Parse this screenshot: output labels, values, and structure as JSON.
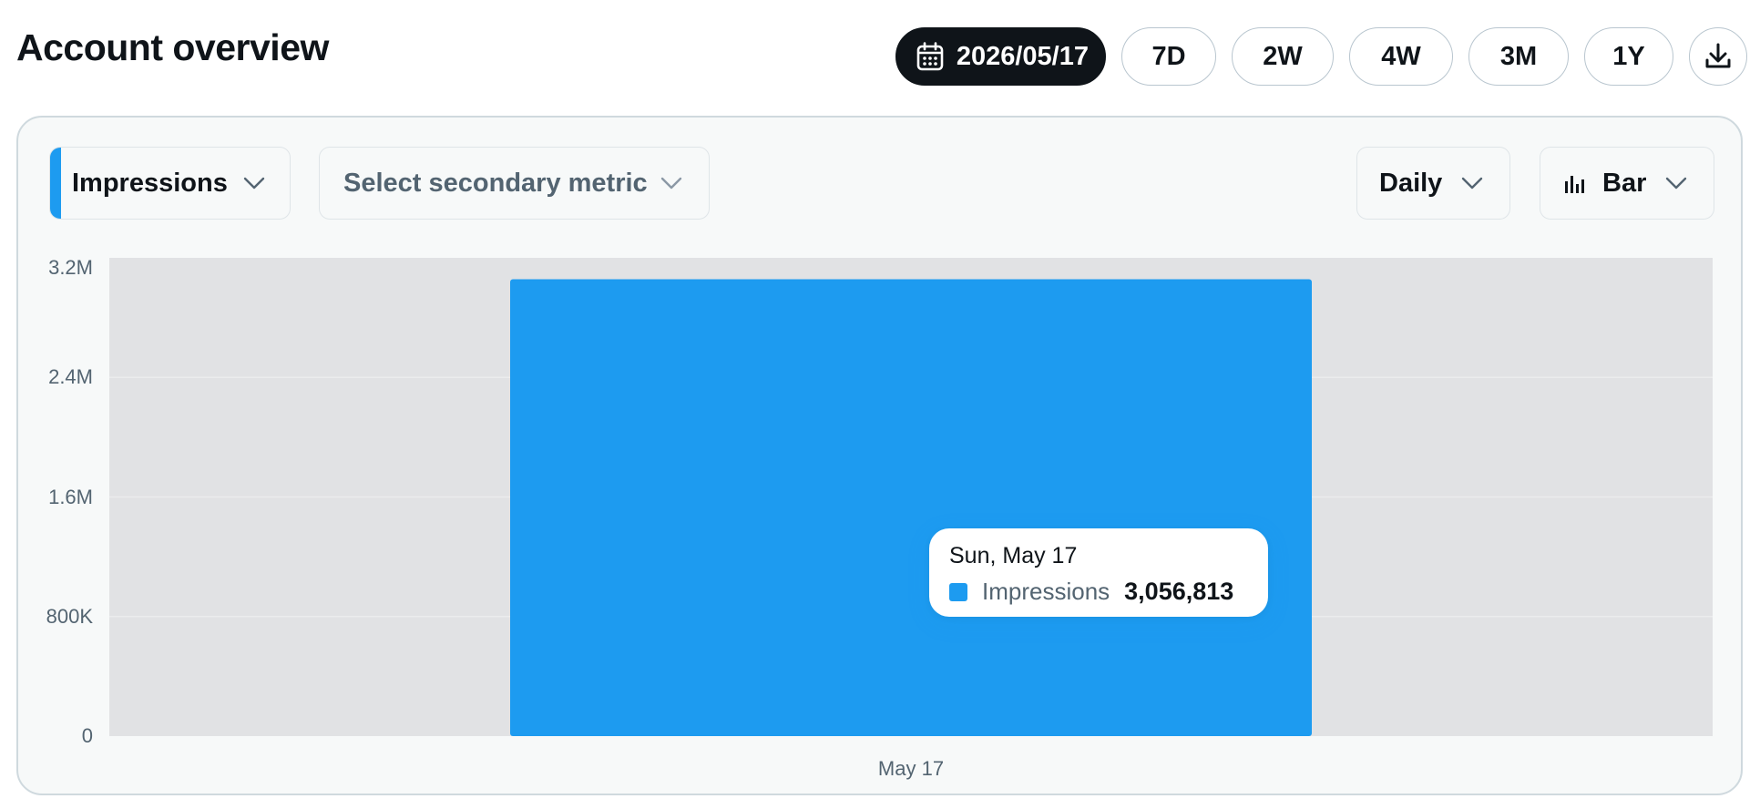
{
  "page": {
    "title": "Account overview"
  },
  "toolbar": {
    "date_label": "2026/05/17",
    "ranges": [
      "7D",
      "2W",
      "4W",
      "3M",
      "1Y"
    ],
    "download_icon": "download-icon",
    "calendar_icon": "calendar-icon"
  },
  "controls": {
    "primary_metric": "Impressions",
    "secondary_metric_placeholder": "Select secondary metric",
    "interval": "Daily",
    "chart_type": "Bar"
  },
  "colors": {
    "accent": "#1d9bf0",
    "plot_bg": "#e1e2e4",
    "card_bg": "#f7f9f9",
    "dark": "#0f1419"
  },
  "chart_data": {
    "type": "bar",
    "categories": [
      "May 17"
    ],
    "series": [
      {
        "name": "Impressions",
        "values": [
          3056813
        ]
      }
    ],
    "ylim": [
      0,
      3200000
    ],
    "yticks": [
      0,
      800000,
      1600000,
      2400000,
      3200000
    ],
    "ytick_labels": [
      "0",
      "800K",
      "1.6M",
      "2.4M",
      "3.2M"
    ],
    "grid": true,
    "tooltip": {
      "date": "Sun, May 17",
      "label": "Impressions",
      "value": "3,056,813"
    }
  }
}
